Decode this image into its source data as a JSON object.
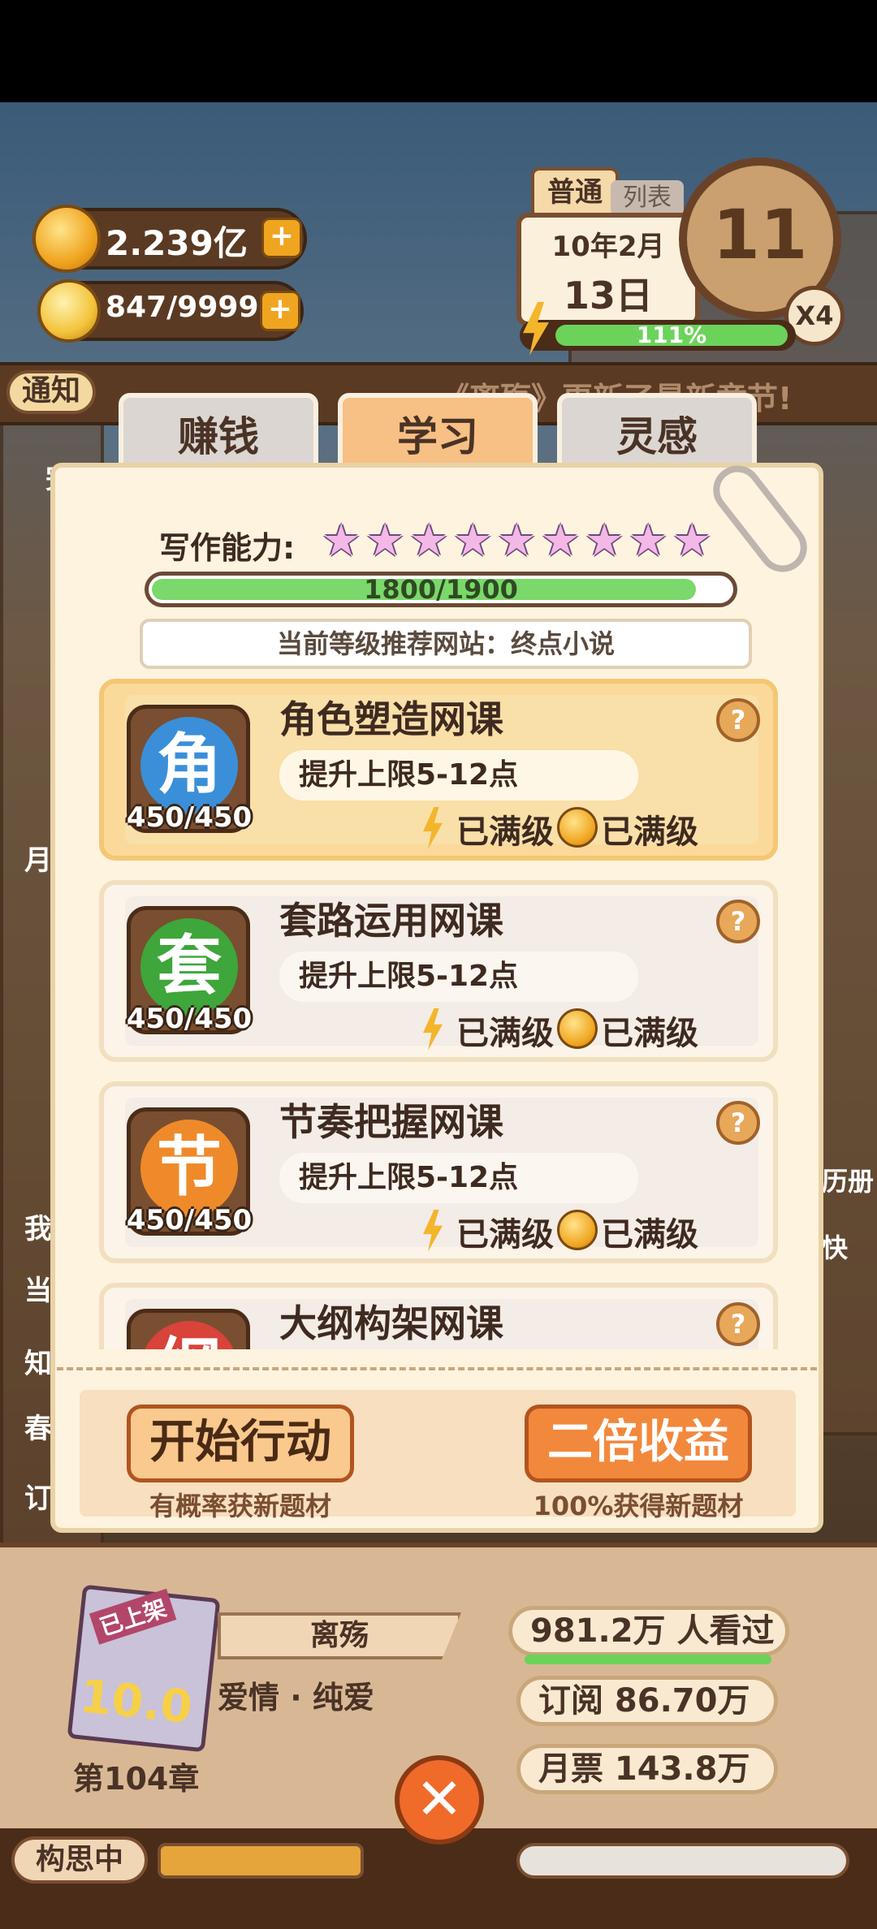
{
  "hud": {
    "gold": "2.239亿",
    "inspiration": "847/9999",
    "mode": "普通",
    "mode_side": "列表",
    "date_line1": "10年2月",
    "date_line2": "13日",
    "clock_value": "11",
    "speed": "X4",
    "energy_percent": "111%",
    "energy_fill": 1.0
  },
  "notice": {
    "label": "通知",
    "text": "《离殇》更新了最新章节!"
  },
  "tabs": [
    {
      "label": "赚钱",
      "active": false
    },
    {
      "label": "学习",
      "active": true
    },
    {
      "label": "灵感",
      "active": false
    }
  ],
  "ability": {
    "label": "写作能力:",
    "stars": 9,
    "progress_text": "1800/1900",
    "progress_fraction": 0.947,
    "recommend": "当前等级推荐网站：终点小说"
  },
  "courses": [
    {
      "icon_char": "角",
      "color": "#3a8fd8",
      "count": "450/450",
      "title": "角色塑造网课",
      "desc": "提升上限5-12点",
      "energy": "已满级",
      "coin": "已满级",
      "active": true
    },
    {
      "icon_char": "套",
      "color": "#3ea63a",
      "count": "450/450",
      "title": "套路运用网课",
      "desc": "提升上限5-12点",
      "energy": "已满级",
      "coin": "已满级",
      "active": false
    },
    {
      "icon_char": "节",
      "color": "#ef8a2a",
      "count": "450/450",
      "title": "节奏把握网课",
      "desc": "提升上限5-12点",
      "energy": "已满级",
      "coin": "已满级",
      "active": false
    },
    {
      "icon_char": "纲",
      "color": "#d8433a",
      "count": "",
      "title": "大纲构架网课",
      "desc": "",
      "energy": "",
      "coin": "",
      "active": false
    }
  ],
  "help_mark": "?",
  "actions": {
    "start_label": "开始行动",
    "start_sub": "有概率获新题材",
    "double_label": "二倍收益",
    "double_sub": "100%获得新题材"
  },
  "book": {
    "tag": "已上架",
    "score": "10.0",
    "title": "离殇",
    "genre": "爱情 · 纯爱",
    "chapter": "第104章",
    "views": "981.2万 人看过",
    "subs": "订阅 86.70万",
    "tickets": "月票 143.8万"
  },
  "bottom": {
    "status": "构思中"
  },
  "side_left": [
    "完",
    "月",
    "我",
    "当",
    "知",
    "春",
    "订"
  ],
  "side_right": [
    "历册",
    "快"
  ]
}
